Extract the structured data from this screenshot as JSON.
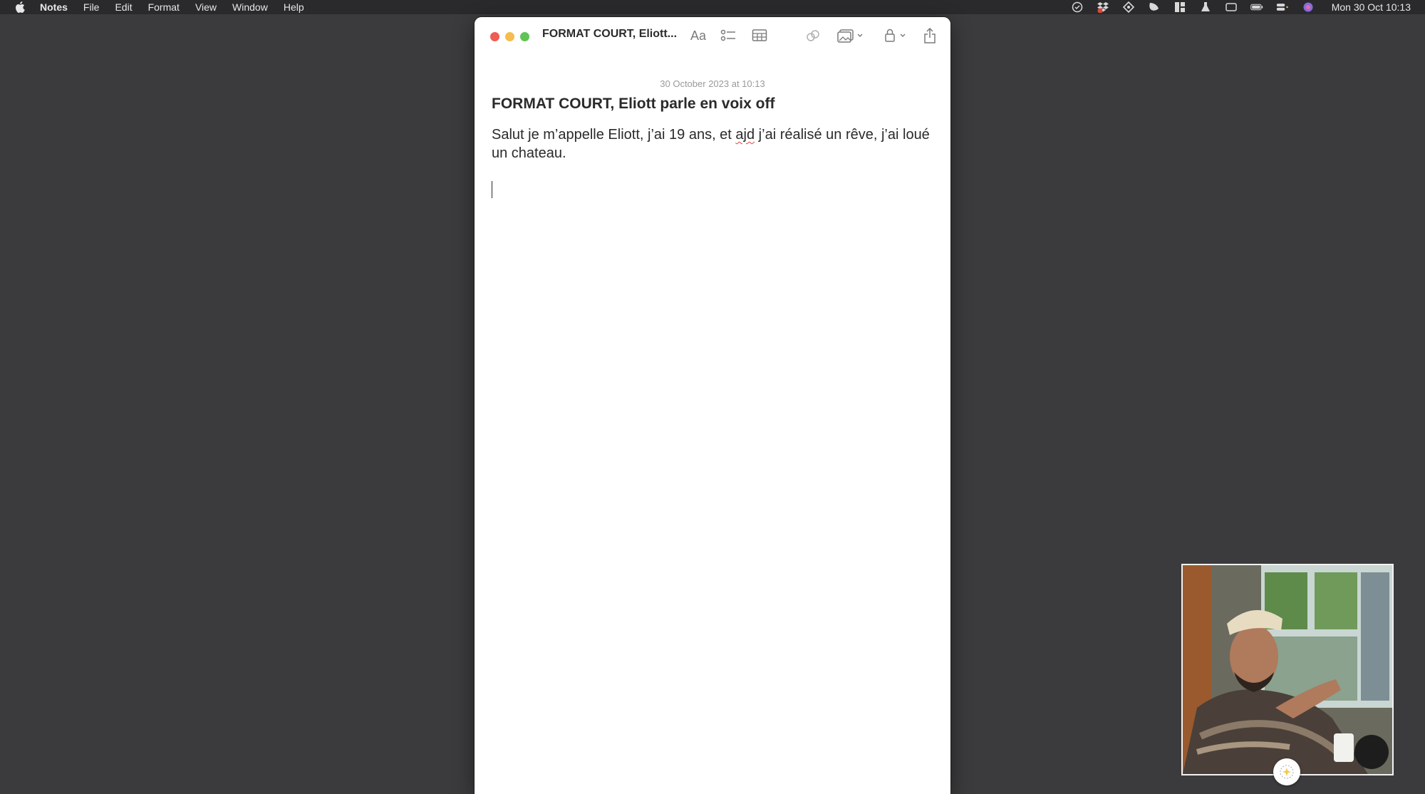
{
  "menubar": {
    "app_name": "Notes",
    "items": [
      "File",
      "Edit",
      "Format",
      "View",
      "Window",
      "Help"
    ],
    "clock": "Mon 30 Oct  10:13"
  },
  "window": {
    "title": "FORMAT COURT, Eliott...",
    "toolbar_icons": [
      "format-text-icon",
      "checklist-icon",
      "table-icon",
      "link-icon",
      "media-icon",
      "lock-icon",
      "share-icon"
    ],
    "format_label": "Aa"
  },
  "note": {
    "date": "30 October 2023 at 10:13",
    "title": "FORMAT COURT, Eliott parle en voix off",
    "body_before": "Salut je m’appelle Eliott, j’ai 19 ans, et ",
    "body_misspelled": "ajd",
    "body_after": " j’ai réalisé un rêve, j’ai loué un chateau."
  },
  "colors": {
    "desktop": "#3b3b3d",
    "menubar": "#2a2a2c",
    "close": "#ee5c53",
    "minimize": "#f4bd4f",
    "maximize": "#5fc454",
    "spellcheck": "#e0433a"
  }
}
